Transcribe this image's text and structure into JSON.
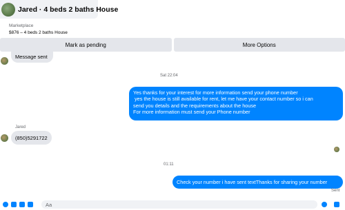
{
  "header": {
    "title": "Jared · 4 beds 2 baths House"
  },
  "marketplace": {
    "label": "Marketplace",
    "item": "$876 – 4 beds 2 baths House"
  },
  "actions": {
    "mark_pending": "Mark as pending",
    "more_options": "More Options"
  },
  "messages": {
    "first_in": "Message sent",
    "timestamp1": "Sat 22:04",
    "out1": [
      "Yes thanks for your interest for more information send your phone number",
      " yes the house is still available for rent, let me have your contact number so i can",
      "send you details and the requirements about the house",
      "For more information must send your Phone number"
    ],
    "sender": "Jared",
    "phone": "(850)5291722",
    "timestamp2": "01:11",
    "out2": "Check your number i have sent textThanks for sharing your number",
    "status": "Sent"
  },
  "composer": {
    "placeholder": "Aa"
  },
  "colors": {
    "accent": "#0084ff",
    "bubble_in": "#e4e6eb",
    "header_bg": "#f0f2f5"
  }
}
